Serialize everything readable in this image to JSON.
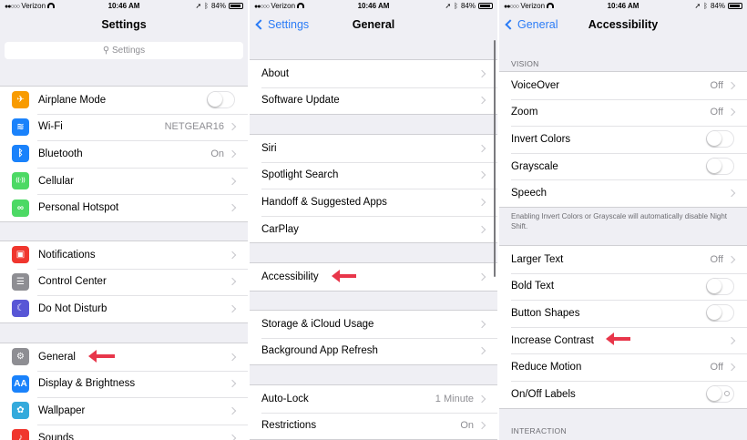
{
  "status": {
    "carrier": "Verizon",
    "time": "10:46 AM",
    "battery": "84%"
  },
  "settings": {
    "title": "Settings",
    "search_placeholder": "Settings",
    "group1": [
      {
        "label": "Airplane Mode",
        "icon": "airplane-icon",
        "color": "#f89b00",
        "control": "toggle",
        "glyph": "✈"
      },
      {
        "label": "Wi-Fi",
        "icon": "wifi-icon",
        "color": "#1a82fb",
        "value": "NETGEAR16",
        "glyph": "≋"
      },
      {
        "label": "Bluetooth",
        "icon": "bluetooth-icon",
        "color": "#1a82fb",
        "value": "On",
        "glyph": "ᛒ"
      },
      {
        "label": "Cellular",
        "icon": "cellular-icon",
        "color": "#4cd964",
        "glyph": "((·))"
      },
      {
        "label": "Personal Hotspot",
        "icon": "hotspot-icon",
        "color": "#4cd964",
        "glyph": "∞"
      }
    ],
    "group2": [
      {
        "label": "Notifications",
        "icon": "notifications-icon",
        "color": "#f0362e",
        "glyph": "▣"
      },
      {
        "label": "Control Center",
        "icon": "control-center-icon",
        "color": "#8e8e93",
        "glyph": "☰"
      },
      {
        "label": "Do Not Disturb",
        "icon": "moon-icon",
        "color": "#5856d6",
        "glyph": "☾"
      }
    ],
    "group3": [
      {
        "label": "General",
        "icon": "gear-icon",
        "color": "#8e8e93",
        "glyph": "⚙"
      },
      {
        "label": "Display & Brightness",
        "icon": "display-icon",
        "color": "#1a82fb",
        "glyph": "AA"
      },
      {
        "label": "Wallpaper",
        "icon": "wallpaper-icon",
        "color": "#34aadc",
        "glyph": "✿"
      },
      {
        "label": "Sounds",
        "icon": "sounds-icon",
        "color": "#f0362e",
        "glyph": "♪"
      }
    ]
  },
  "general": {
    "back": "Settings",
    "title": "General",
    "group1": [
      {
        "label": "About"
      },
      {
        "label": "Software Update"
      }
    ],
    "group2": [
      {
        "label": "Siri"
      },
      {
        "label": "Spotlight Search"
      },
      {
        "label": "Handoff & Suggested Apps"
      },
      {
        "label": "CarPlay"
      }
    ],
    "group3": [
      {
        "label": "Accessibility"
      }
    ],
    "group4": [
      {
        "label": "Storage & iCloud Usage"
      },
      {
        "label": "Background App Refresh"
      }
    ],
    "group5": [
      {
        "label": "Auto-Lock",
        "value": "1 Minute"
      },
      {
        "label": "Restrictions",
        "value": "On"
      }
    ]
  },
  "accessibility": {
    "back": "General",
    "title": "Accessibility",
    "vision_header": "VISION",
    "group1": [
      {
        "label": "VoiceOver",
        "value": "Off",
        "control": "arrow"
      },
      {
        "label": "Zoom",
        "value": "Off",
        "control": "arrow"
      },
      {
        "label": "Invert Colors",
        "control": "toggle"
      },
      {
        "label": "Grayscale",
        "control": "toggle"
      },
      {
        "label": "Speech",
        "control": "arrow"
      }
    ],
    "footnote": "Enabling Invert Colors or Grayscale will automatically disable Night Shift.",
    "group2": [
      {
        "label": "Larger Text",
        "value": "Off",
        "control": "arrow"
      },
      {
        "label": "Bold Text",
        "control": "toggle"
      },
      {
        "label": "Button Shapes",
        "control": "toggle"
      },
      {
        "label": "Increase Contrast",
        "control": "arrow"
      },
      {
        "label": "Reduce Motion",
        "value": "Off",
        "control": "arrow"
      },
      {
        "label": "On/Off Labels",
        "control": "toggle-labels"
      }
    ],
    "interaction_header": "INTERACTION"
  },
  "colors": {
    "accent": "#2b7cf6",
    "annotation_arrow": "#e8364a"
  }
}
